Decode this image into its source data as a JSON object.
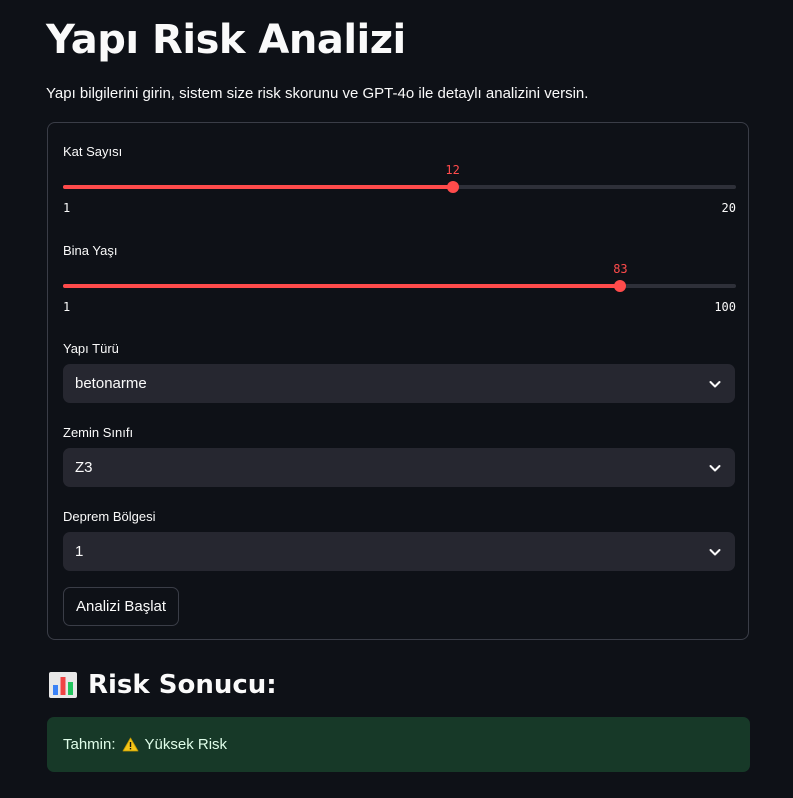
{
  "header": {
    "title": "Yapı Risk Analizi",
    "subtitle": "Yapı bilgilerini girin, sistem size risk skorunu ve GPT-4o ile detaylı analizini versin."
  },
  "form": {
    "kat_sayisi": {
      "label": "Kat Sayısı",
      "value": 12,
      "min": 1,
      "max": 20
    },
    "bina_yasi": {
      "label": "Bina Yaşı",
      "value": 83,
      "min": 1,
      "max": 100
    },
    "yapi_turu": {
      "label": "Yapı Türü",
      "value": "betonarme"
    },
    "zemin_sinifi": {
      "label": "Zemin Sınıfı",
      "value": "Z3"
    },
    "deprem_bolgesi": {
      "label": "Deprem Bölgesi",
      "value": "1"
    },
    "submit_label": "Analizi Başlat"
  },
  "result": {
    "heading": "Risk Sonucu:",
    "heading_icon": "bar-chart-icon",
    "prefix": "Tahmin:",
    "icon": "warning-icon",
    "value": "Yüksek Risk"
  },
  "colors": {
    "accent": "#ff4b4b",
    "background": "#0e1117",
    "input_bg": "#262730",
    "success_bg": "#173928"
  }
}
